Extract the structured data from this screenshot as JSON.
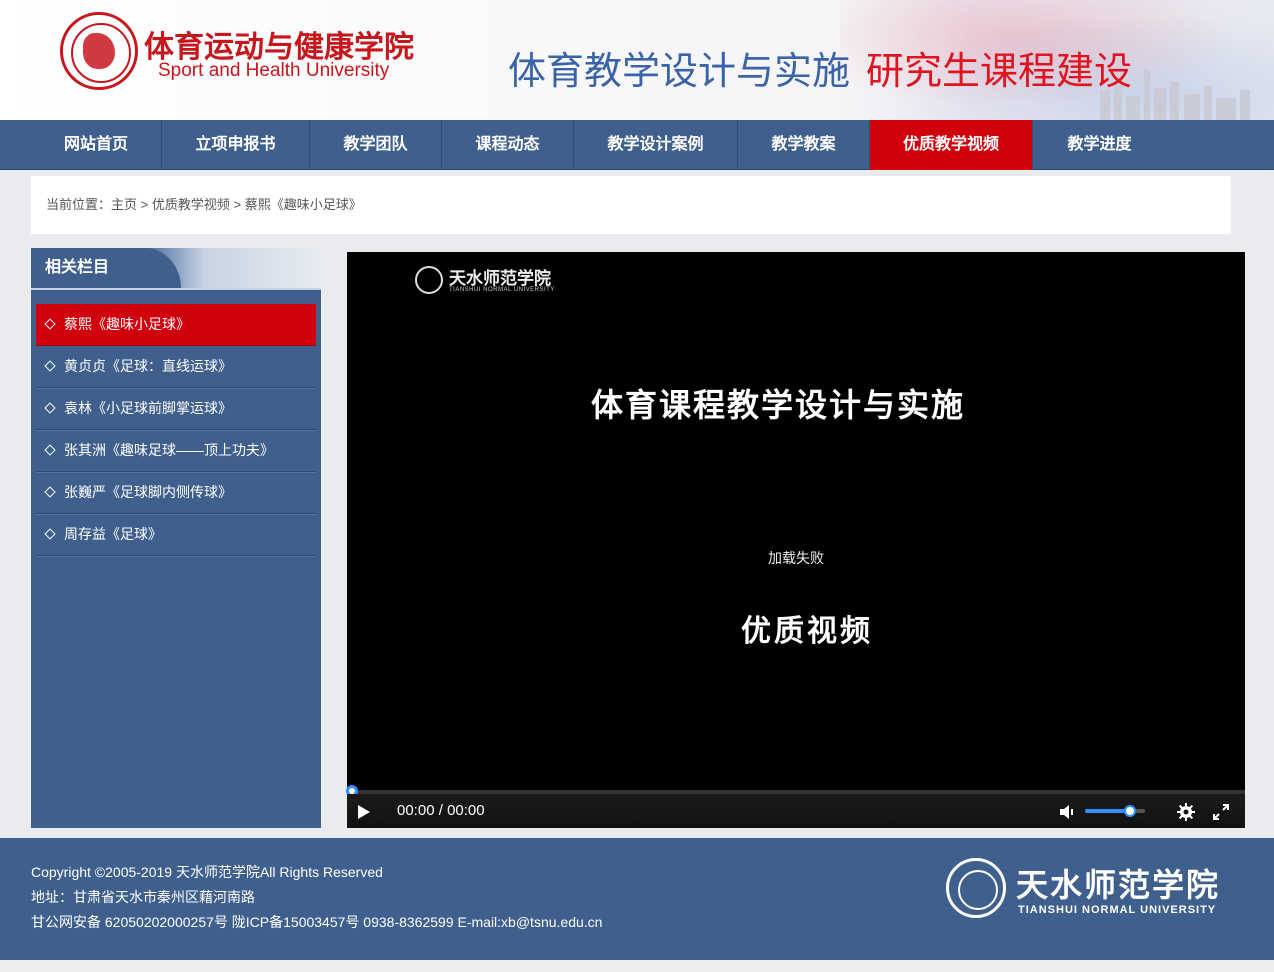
{
  "header": {
    "logo_cn": "体育运动与健康学院",
    "logo_en": "Sport and Health University",
    "banner_blue": "体育教学设计与实施",
    "banner_red": "研究生课程建设"
  },
  "nav": {
    "items": [
      {
        "label": "网站首页"
      },
      {
        "label": "立项申报书"
      },
      {
        "label": "教学团队"
      },
      {
        "label": "课程动态"
      },
      {
        "label": "教学设计案例"
      },
      {
        "label": "教学教案"
      },
      {
        "label": "优质教学视频",
        "active": true
      },
      {
        "label": "教学进度"
      }
    ]
  },
  "breadcrumb": {
    "prefix": "当前位置：",
    "home": "主页",
    "sep": " > ",
    "section": "优质教学视频",
    "current": "蔡熙《趣味小足球》"
  },
  "sidebar": {
    "title": "相关栏目",
    "items": [
      {
        "label": "蔡熙《趣味小足球》",
        "active": true
      },
      {
        "label": "黄贞贞《足球：直线运球》"
      },
      {
        "label": "袁林《小足球前脚掌运球》"
      },
      {
        "label": "张其洲《趣味足球——顶上功夫》"
      },
      {
        "label": "张巍严《足球脚内侧传球》"
      },
      {
        "label": "周存益《足球》"
      }
    ]
  },
  "video": {
    "logo_cn": "天水师范学院",
    "logo_en": "TIANSHUI NORMAL UNIVERSITY",
    "title": "体育课程教学设计与实施",
    "status": "加载失败",
    "subtitle": "优质视频",
    "time_current": "00:00",
    "time_sep": " / ",
    "time_total": "00:00",
    "progress": 0,
    "volume": 0.75,
    "accent": "#2f8fff"
  },
  "footer": {
    "copyright": "Copyright ©2005-2019   天水师范学院All Rights Reserved",
    "address": "地址：甘肃省天水市秦州区藉河南路",
    "license": "甘公网安备 62050202000257号 陇ICP备15003457号   0938-8362599   E-mail:xb@tsnu.edu.cn",
    "logo_cn": "天水师范学院",
    "logo_en": "TIANSHUI NORMAL UNIVERSITY"
  },
  "colors": {
    "brand_blue": "#3f5f8d",
    "active_red": "#d0000d",
    "logo_red": "#c8161d"
  }
}
